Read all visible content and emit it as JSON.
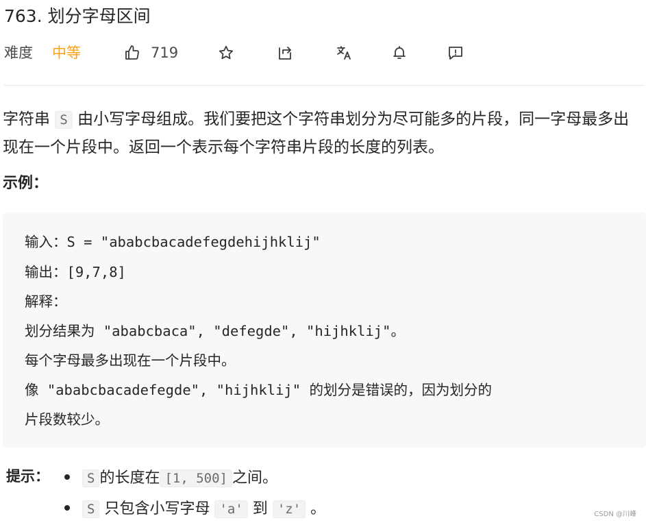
{
  "problem": {
    "title": "763. 划分字母区间",
    "difficulty_label": "难度",
    "difficulty": "中等",
    "likes": "719",
    "icons": [
      "thumbs-up-icon",
      "star-icon",
      "share-icon",
      "translate-icon",
      "bell-icon",
      "feedback-icon"
    ]
  },
  "description": {
    "part1": "字符串 ",
    "var_s": "S",
    "part2": " 由小写字母组成。我们要把这个字符串划分为尽可能多的片段，同一字母最多出现在一个片段中。返回一个表示每个字符串片段的长度的列表。"
  },
  "example": {
    "heading": "示例：",
    "lines": [
      "输入：S = \"ababcbacadefegdehijhklij\"",
      "输出：[9,7,8]",
      "解释：",
      "划分结果为 \"ababcbaca\", \"defegde\", \"hijhklij\"。",
      "每个字母最多出现在一个片段中。",
      "像 \"ababcbacadefegde\", \"hijhklij\" 的划分是错误的，因为划分的",
      "片段数较少。"
    ]
  },
  "hints": {
    "label": "提示：",
    "item1": {
      "code1": "S",
      "text1": "的长度在",
      "code2": "[1, 500]",
      "text2": "之间。"
    },
    "item2": {
      "code1": "S",
      "text1": "只包含小写字母",
      "code2": "'a'",
      "text2": "到",
      "code3": "'z'",
      "text3": "。"
    }
  },
  "watermark": "CSDN @川峰",
  "colors": {
    "difficulty_medium": "#ffa116",
    "code_bg": "#f2f3f4",
    "example_bg": "#f7f8fa"
  }
}
